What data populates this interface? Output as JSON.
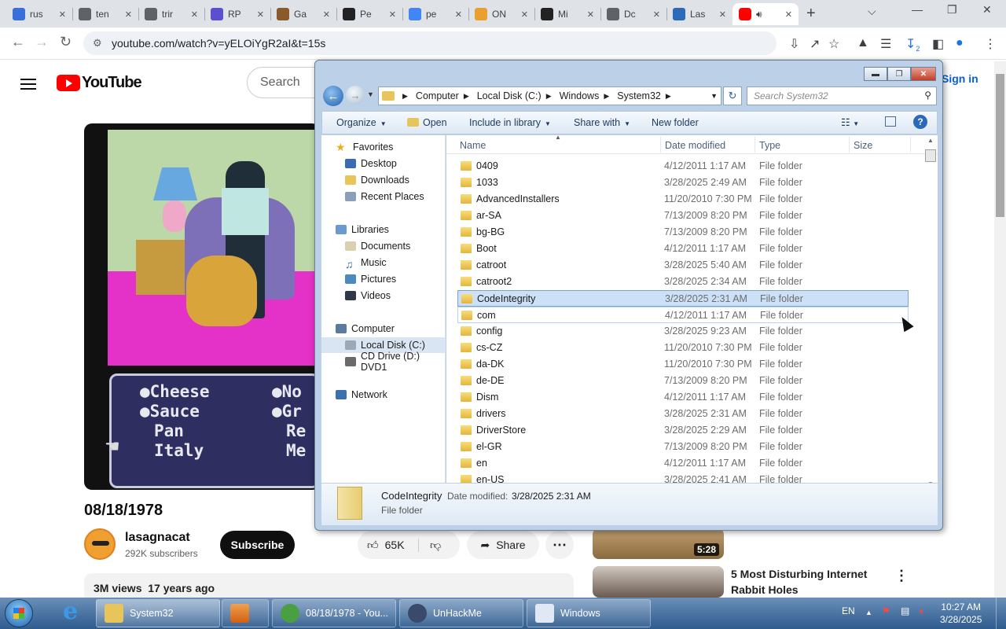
{
  "browser": {
    "tabs": [
      {
        "label": "rus",
        "color": "#3b6fd8"
      },
      {
        "label": "ten",
        "color": "#5f6368"
      },
      {
        "label": "trir",
        "color": "#5f6368"
      },
      {
        "label": "RP",
        "color": "#5b4fcf"
      },
      {
        "label": "Ga",
        "color": "#8a5a2a"
      },
      {
        "label": "Pe",
        "color": "#222222"
      },
      {
        "label": "pe",
        "color": "#4285f4"
      },
      {
        "label": "ON",
        "color": "#e8a030"
      },
      {
        "label": "Mi",
        "color": "#222222"
      },
      {
        "label": "Dc",
        "color": "#5f6368"
      },
      {
        "label": "Las",
        "color": "#2a6ab8"
      }
    ],
    "active_tab": {
      "label": "",
      "icon": "youtube-icon"
    },
    "url": "youtube.com/watch?v=yELOiYgR2aI&t=15s",
    "download_badge": "2"
  },
  "youtube": {
    "logo_text": "YouTube",
    "search_placeholder": "Search",
    "signin_label": "Sign in",
    "video_title": "08/18/1978",
    "game_menu": [
      "Cheese",
      "Sauce",
      "Pan",
      "Italy",
      "No",
      "Gr",
      "Re",
      "Me"
    ],
    "channel_name": "lasagnacat",
    "subscribers": "292K subscribers",
    "subscribe_label": "Subscribe",
    "likes": "65K",
    "share_label": "Share",
    "views": "3M views",
    "posted": "17 years ago",
    "recommendations": [
      {
        "duration": "5:28",
        "title": ""
      },
      {
        "duration": "",
        "title": "5 Most Disturbing Internet Rabbit Holes"
      }
    ]
  },
  "explorer": {
    "breadcrumbs": [
      "Computer",
      "Local Disk (C:)",
      "Windows",
      "System32"
    ],
    "search_placeholder": "Search System32",
    "commands": {
      "organize": "Organize",
      "open": "Open",
      "include": "Include in library",
      "share": "Share with",
      "new_folder": "New folder"
    },
    "nav": {
      "favorites": "Favorites",
      "desktop": "Desktop",
      "downloads": "Downloads",
      "recent": "Recent Places",
      "libraries": "Libraries",
      "documents": "Documents",
      "music": "Music",
      "pictures": "Pictures",
      "videos": "Videos",
      "computer": "Computer",
      "local_disk": "Local Disk (C:)",
      "cd_drive": "CD Drive (D:) DVD1",
      "network": "Network"
    },
    "columns": {
      "name": "Name",
      "date": "Date modified",
      "type": "Type",
      "size": "Size"
    },
    "files": [
      {
        "name": "0409",
        "date": "4/12/2011 1:17 AM",
        "type": "File folder"
      },
      {
        "name": "1033",
        "date": "3/28/2025 2:49 AM",
        "type": "File folder"
      },
      {
        "name": "AdvancedInstallers",
        "date": "11/20/2010 7:30 PM",
        "type": "File folder"
      },
      {
        "name": "ar-SA",
        "date": "7/13/2009 8:20 PM",
        "type": "File folder"
      },
      {
        "name": "bg-BG",
        "date": "7/13/2009 8:20 PM",
        "type": "File folder"
      },
      {
        "name": "Boot",
        "date": "4/12/2011 1:17 AM",
        "type": "File folder"
      },
      {
        "name": "catroot",
        "date": "3/28/2025 5:40 AM",
        "type": "File folder"
      },
      {
        "name": "catroot2",
        "date": "3/28/2025 2:34 AM",
        "type": "File folder"
      },
      {
        "name": "CodeIntegrity",
        "date": "3/28/2025 2:31 AM",
        "type": "File folder"
      },
      {
        "name": "com",
        "date": "4/12/2011 1:17 AM",
        "type": "File folder"
      },
      {
        "name": "config",
        "date": "3/28/2025 9:23 AM",
        "type": "File folder"
      },
      {
        "name": "cs-CZ",
        "date": "11/20/2010 7:30 PM",
        "type": "File folder"
      },
      {
        "name": "da-DK",
        "date": "11/20/2010 7:30 PM",
        "type": "File folder"
      },
      {
        "name": "de-DE",
        "date": "7/13/2009 8:20 PM",
        "type": "File folder"
      },
      {
        "name": "Dism",
        "date": "4/12/2011 1:17 AM",
        "type": "File folder"
      },
      {
        "name": "drivers",
        "date": "3/28/2025 2:31 AM",
        "type": "File folder"
      },
      {
        "name": "DriverStore",
        "date": "3/28/2025 2:29 AM",
        "type": "File folder"
      },
      {
        "name": "el-GR",
        "date": "7/13/2009 8:20 PM",
        "type": "File folder"
      },
      {
        "name": "en",
        "date": "4/12/2011 1:17 AM",
        "type": "File folder"
      },
      {
        "name": "en-US",
        "date": "3/28/2025 2:41 AM",
        "type": "File folder"
      }
    ],
    "selected_index": 8,
    "hover_index": 9,
    "details": {
      "name": "CodeIntegrity",
      "date_label": "Date modified:",
      "date_value": "3/28/2025 2:31 AM",
      "type": "File folder"
    }
  },
  "taskbar": {
    "buttons": [
      {
        "label": "System32",
        "color": "#e8c55a"
      },
      {
        "label": "08/18/1978 - You...",
        "color": "#4aa040"
      },
      {
        "label": "UnHackMe",
        "color": "#3a4a6a"
      },
      {
        "label": "Windows",
        "color": "#dfe8f4"
      }
    ],
    "lang": "EN",
    "time": "10:27 AM",
    "date": "3/28/2025"
  }
}
